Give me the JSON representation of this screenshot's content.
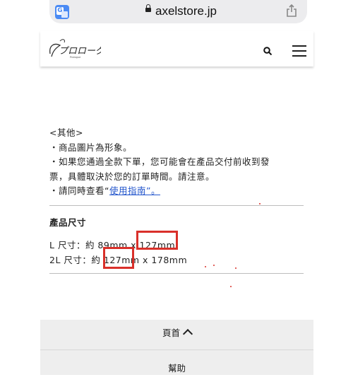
{
  "browser": {
    "url": "axelstore.jp"
  },
  "header": {
    "logo_text": "プロローグ",
    "logo_subtext": "Prologue"
  },
  "notes": {
    "heading": "<其他>",
    "line1": "・商品圖片為形象。",
    "line2": "・如果您通過全款下單，您可能會在產品交付前收到發",
    "line3": "票，具體取決於您的訂單時間。請注意。",
    "line4_prefix": "・請同時查看“",
    "line4_link": "使用指南",
    "line4_suffix": "”。"
  },
  "sizes": {
    "title": "產品尺寸",
    "l_size": "L 尺寸：約 89mm x 127mm",
    "l2_size": "2L 尺寸：約 127mm x 178mm"
  },
  "footer": {
    "top_label": "頁首",
    "help_label": "幫助"
  },
  "colors": {
    "highlight": "#d9302a",
    "link": "#2255cc"
  }
}
